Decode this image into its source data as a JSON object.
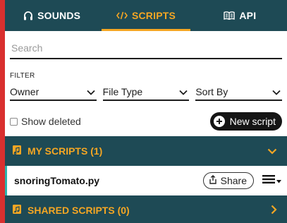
{
  "tabs": [
    {
      "label": "SOUNDS",
      "icon": "headphones-icon"
    },
    {
      "label": "SCRIPTS",
      "icon": "code-icon"
    },
    {
      "label": "API",
      "icon": "book-icon"
    }
  ],
  "active_tab": "SCRIPTS",
  "search": {
    "placeholder": "Search",
    "value": ""
  },
  "filter": {
    "heading": "FILTER",
    "owner": "Owner",
    "file_type": "File Type",
    "sort_by": "Sort By"
  },
  "show_deleted": {
    "label": "Show deleted",
    "checked": false
  },
  "new_script_label": "New script",
  "my_scripts": {
    "label": "MY SCRIPTS (1)",
    "items": [
      {
        "name": "snoringTomato.py",
        "share_label": "Share"
      }
    ]
  },
  "shared_scripts": {
    "label": "SHARED SCRIPTS (0)"
  },
  "colors": {
    "header_bg": "#1e4a55",
    "accent": "#f5a623",
    "frame": "#d9302f",
    "item_marker": "#2bb3ac"
  }
}
